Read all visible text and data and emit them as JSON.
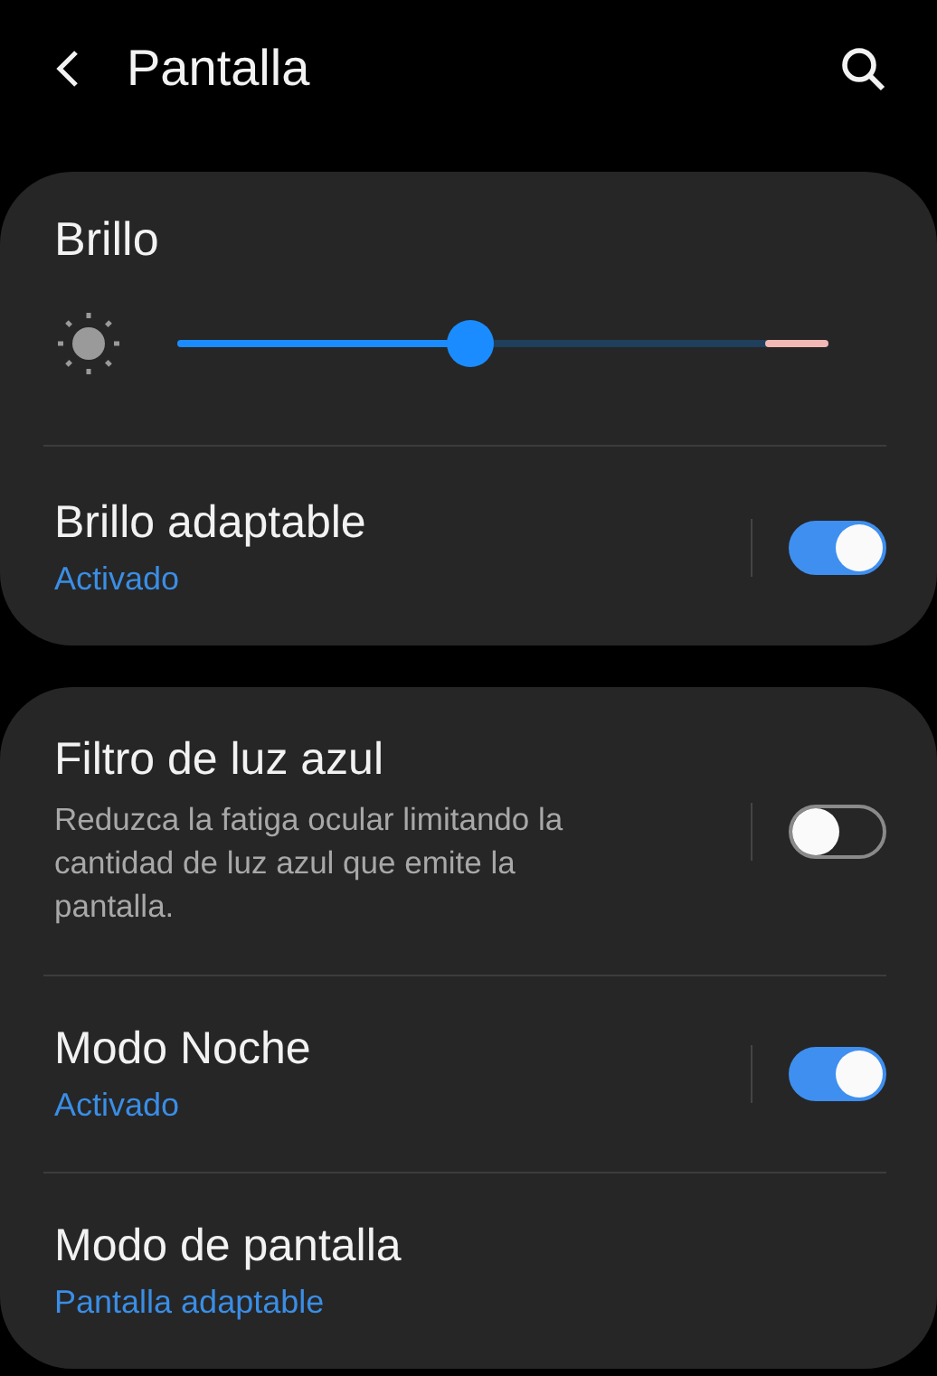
{
  "header": {
    "title": "Pantalla"
  },
  "brightness": {
    "title": "Brillo",
    "level": 0.45
  },
  "cards": [
    {
      "items": [
        {
          "kind": "toggle",
          "title": "Brillo adaptable",
          "subtitle": "Activado",
          "on": true
        }
      ]
    },
    {
      "items": [
        {
          "kind": "toggle",
          "title": "Filtro de luz azul",
          "description": "Reduzca la fatiga ocular limitando la cantidad de luz azul que emite la pantalla.",
          "on": false
        },
        {
          "kind": "toggle",
          "title": "Modo Noche",
          "subtitle": "Activado",
          "on": true
        },
        {
          "kind": "plain",
          "title": "Modo de pantalla",
          "subtitle": "Pantalla adaptable"
        }
      ]
    }
  ]
}
